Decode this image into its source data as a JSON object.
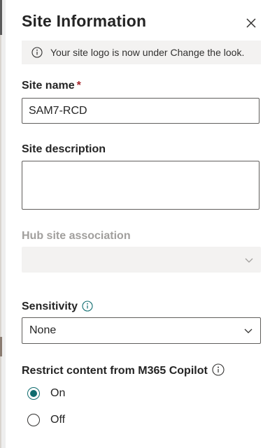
{
  "panel": {
    "title": "Site Information",
    "close_icon": "close-icon"
  },
  "notice": {
    "icon": "info-icon",
    "text": "Your site logo is now under Change the look."
  },
  "site_name": {
    "label": "Site name",
    "required_marker": "*",
    "value": "SAM7-RCD"
  },
  "site_description": {
    "label": "Site description",
    "value": ""
  },
  "hub_site": {
    "label": "Hub site association",
    "value": "",
    "disabled": true
  },
  "sensitivity": {
    "label": "Sensitivity",
    "value": "None"
  },
  "copilot": {
    "label": "Restrict content from M365 Copilot",
    "options": [
      {
        "label": "On",
        "checked": true
      },
      {
        "label": "Off",
        "checked": false
      }
    ]
  },
  "colors": {
    "accent": "#0f6c6f",
    "required": "#a4262c",
    "disabled_text": "#a19f9d",
    "notice_bg": "#f3f2f1"
  }
}
